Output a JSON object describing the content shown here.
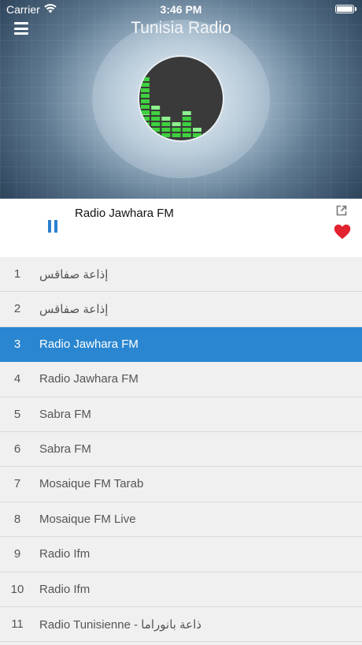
{
  "status_bar": {
    "carrier": "Carrier",
    "time": "3:46 PM"
  },
  "header": {
    "title": "Tunisia Radio",
    "menu_icon": "hamburger-menu-icon"
  },
  "now_playing": {
    "station": "Radio Jawhara FM",
    "state_icon": "pause-icon",
    "share_icon": "share-icon",
    "favorite_icon": "heart-icon",
    "favorite_color": "#e2232f",
    "accent_color": "#2a86d0"
  },
  "stations": [
    {
      "num": "1",
      "name": "إذاعة صفاقس",
      "selected": false
    },
    {
      "num": "2",
      "name": "إذاعة صفاقس",
      "selected": false
    },
    {
      "num": "3",
      "name": "Radio Jawhara FM",
      "selected": true
    },
    {
      "num": "4",
      "name": "Radio Jawhara FM",
      "selected": false
    },
    {
      "num": "5",
      "name": "Sabra FM",
      "selected": false
    },
    {
      "num": "6",
      "name": "Sabra FM",
      "selected": false
    },
    {
      "num": "7",
      "name": "Mosaique FM Tarab",
      "selected": false
    },
    {
      "num": "8",
      "name": "Mosaique FM Live",
      "selected": false
    },
    {
      "num": "9",
      "name": "Radio Ifm",
      "selected": false
    },
    {
      "num": "10",
      "name": "Radio Ifm",
      "selected": false
    },
    {
      "num": "11",
      "name": "Radio Tunisienne - ذاعة بانوراما",
      "selected": false
    }
  ]
}
